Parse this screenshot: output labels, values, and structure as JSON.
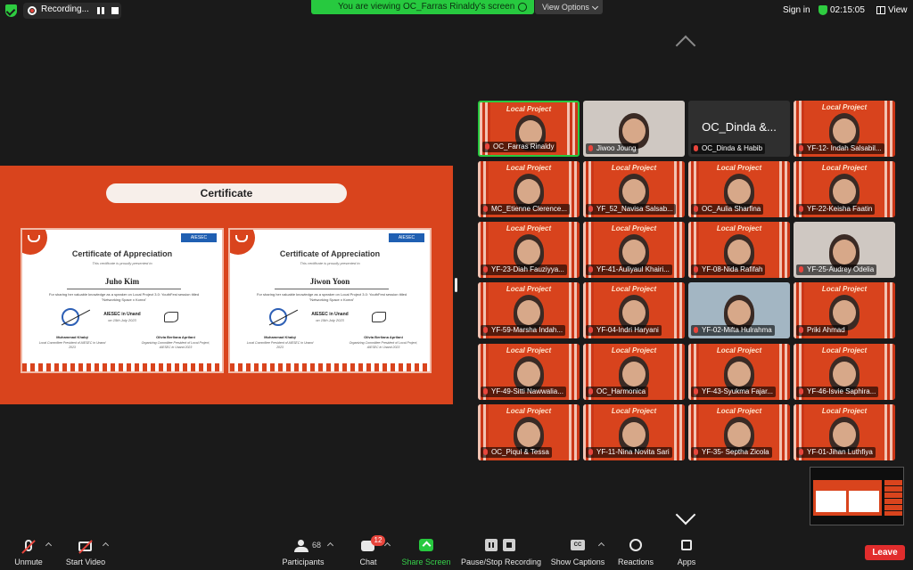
{
  "topbar": {
    "recording_label": "Recording...",
    "viewing_banner": "You are viewing OC_Farras Rinaldy's screen",
    "view_options": "View Options",
    "sign_in": "Sign in",
    "clock": "02:15:05",
    "view_label": "View"
  },
  "slide": {
    "title": "Certificate",
    "certificates": [
      {
        "org": "AIESEC",
        "heading": "Certificate of Appreciation",
        "subheading": "This certificate is proudly presented to",
        "recipient": "Juho Kim",
        "body": "For sharing her valuable knowledge as a speaker on Local Project 3.0: YouthFest session titled \"Networking Space x Korea\"",
        "held_by": "held by",
        "host": "AIESEC in Unand",
        "date": "on 15th July 2023",
        "signer_left": "Muhammad Khalqi",
        "signer_left_role": "Local Committee President of AIESEC in Unand 2023",
        "signer_right": "Olivia Berliana Aprilani",
        "signer_right_role": "Organizing Committee President of Local Project, AIESEC in Unand 2023"
      },
      {
        "org": "AIESEC",
        "heading": "Certificate of Appreciation",
        "subheading": "This certificate is proudly presented to",
        "recipient": "Jiwon Yoon",
        "body": "For sharing her valuable knowledge as a speaker on Local Project 3.0: YouthFest session titled \"Networking Space x Korea\"",
        "held_by": "held by",
        "host": "AIESEC in Unand",
        "date": "on 15th July 2023",
        "signer_left": "Muhammad Khalqi",
        "signer_left_role": "Local Committee President of AIESEC in Unand 2023",
        "signer_right": "Olivia Berliana Aprilani",
        "signer_right_role": "Organizing Committee President of Local Project, AIESEC in Unand 2023"
      }
    ]
  },
  "tile_background_text": "Local Project",
  "participants": [
    {
      "name": "OC_Farras Rinaldy",
      "style": "bg",
      "active": true
    },
    {
      "name": "Jiwoo Joung",
      "style": "photo"
    },
    {
      "name": "OC_Dinda & Habib",
      "style": "dark",
      "big": "OC_Dinda &..."
    },
    {
      "name": "YF-12- Indah Salsabil...",
      "style": "bg"
    },
    {
      "name": "MC_Etienne Clerence...",
      "style": "bg"
    },
    {
      "name": "YF_52_Navisa Salsab...",
      "style": "bg"
    },
    {
      "name": "OC_Aulia Sharfina",
      "style": "bg"
    },
    {
      "name": "YF-22-Keisha Faatin",
      "style": "bg"
    },
    {
      "name": "YF-23-Diah Fauziyya...",
      "style": "bg"
    },
    {
      "name": "YF-41-Auliyaul Khairi...",
      "style": "bg"
    },
    {
      "name": "YF-08-Nida Rafifah",
      "style": "bg"
    },
    {
      "name": "YF-25-Audrey Odelia",
      "style": "photo"
    },
    {
      "name": "YF-59-Marsha Indah...",
      "style": "bg"
    },
    {
      "name": "YF-04-Indri Haryani",
      "style": "bg"
    },
    {
      "name": "YF-02-Mifta Hulrahma",
      "style": "camera"
    },
    {
      "name": "Priki Ahmad",
      "style": "bg"
    },
    {
      "name": "YF-49-Sitti Nawwalia...",
      "style": "bg"
    },
    {
      "name": "OC_Harmonica",
      "style": "bg"
    },
    {
      "name": "YF-43-Syukma Fajar...",
      "style": "bg"
    },
    {
      "name": "YF-46-Isvie Saphira...",
      "style": "bg"
    },
    {
      "name": "OC_Piqul & Tessa",
      "style": "bg"
    },
    {
      "name": "YF-11-Nina Novita Sari",
      "style": "bg"
    },
    {
      "name": "YF-35- Septha Zicola",
      "style": "bg"
    },
    {
      "name": "YF-01-Jihan Luthfiya",
      "style": "bg"
    }
  ],
  "toolbar": {
    "unmute": "Unmute",
    "start_video": "Start Video",
    "participants": "Participants",
    "participants_count": "68",
    "chat": "Chat",
    "chat_badge": "12",
    "share_screen": "Share Screen",
    "record": "Pause/Stop Recording",
    "captions": "Show Captions",
    "captions_icon": "CC",
    "reactions": "Reactions",
    "apps": "Apps",
    "leave": "Leave"
  },
  "colors": {
    "slide_orange": "#d9441d",
    "active_green": "#27c93f",
    "leave_red": "#e12d2d"
  }
}
